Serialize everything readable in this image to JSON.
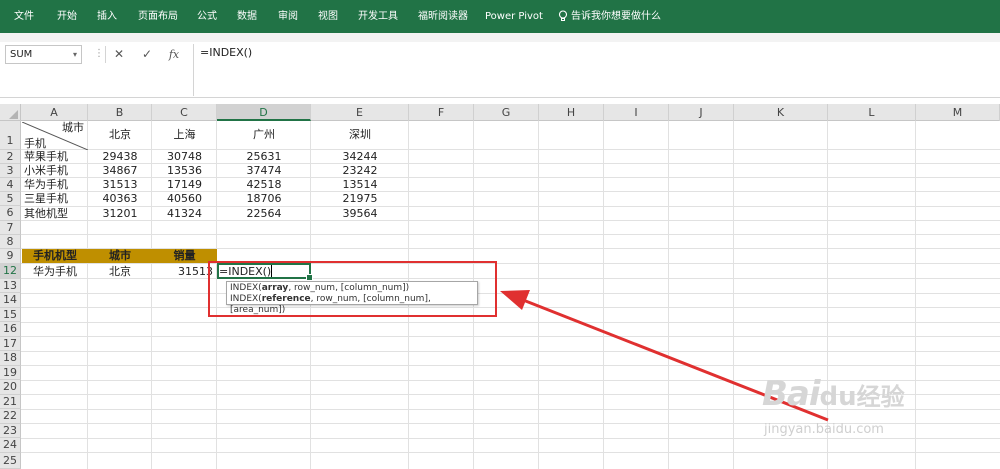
{
  "ribbon": {
    "tabs": [
      "文件",
      "开始",
      "插入",
      "页面布局",
      "公式",
      "数据",
      "审阅",
      "视图",
      "开发工具",
      "福昕阅读器",
      "Power Pivot"
    ],
    "tell_me": "告诉我你想要做什么",
    "bg": "#217346"
  },
  "formula_bar": {
    "name_box": "SUM",
    "cancel_glyph": "✕",
    "enter_glyph": "✓",
    "fx_glyph": "fx",
    "formula": "=INDEX()"
  },
  "columns": [
    "A",
    "B",
    "C",
    "D",
    "E",
    "F",
    "G",
    "H",
    "I",
    "J",
    "K",
    "L",
    "M"
  ],
  "rows": [
    "1",
    "2",
    "3",
    "4",
    "5",
    "6",
    "7",
    "8",
    "9",
    "10",
    "11",
    "12",
    "13",
    "14",
    "15",
    "16",
    "17",
    "18",
    "19",
    "20",
    "21",
    "22",
    "23"
  ],
  "table": {
    "corner_top": "城市",
    "corner_bottom": "手机",
    "cities": [
      "北京",
      "上海",
      "广州",
      "深圳"
    ],
    "data_rows": [
      {
        "phone": "苹果手机",
        "values": [
          "29438",
          "30748",
          "25631",
          "34244"
        ]
      },
      {
        "phone": "小米手机",
        "values": [
          "34867",
          "13536",
          "37474",
          "23242"
        ]
      },
      {
        "phone": "华为手机",
        "values": [
          "31513",
          "17149",
          "42518",
          "13514"
        ]
      },
      {
        "phone": "三星手机",
        "values": [
          "40363",
          "40560",
          "18706",
          "21975"
        ]
      },
      {
        "phone": "其他机型",
        "values": [
          "31201",
          "41324",
          "22564",
          "39564"
        ]
      }
    ]
  },
  "lookup": {
    "headers": [
      "手机机型",
      "城市",
      "销量"
    ],
    "phone": "华为手机",
    "city": "北京",
    "sales": "31513",
    "header_color": "#bf8f00"
  },
  "editing": {
    "cell_text": "=INDEX()"
  },
  "tooltip": {
    "line1_prefix": "INDEX(",
    "line1_bold": "array",
    "line1_rest": ", row_num, [column_num])",
    "line2_prefix": "INDEX(",
    "line2_bold": "reference",
    "line2_rest": ", row_num, [column_num], [area_num])"
  },
  "annotation": {
    "color": "#e03030"
  },
  "watermark": {
    "logo": "Bai",
    "paw": "du",
    "cn": "经验",
    "url": "jingyan.baidu.com"
  }
}
